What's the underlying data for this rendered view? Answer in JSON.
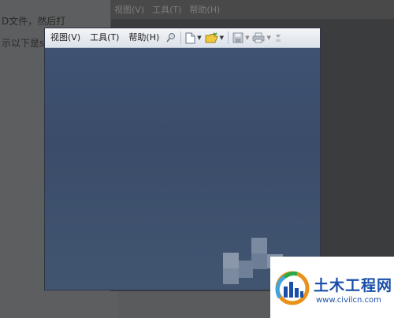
{
  "background_article": {
    "line1": "D文件，然后打",
    "line2": "示以下是s"
  },
  "background_window": {
    "menu": [
      "视图(V)",
      "工具(T)",
      "帮助(H)"
    ]
  },
  "menubar": {
    "view_label": "视图(V)",
    "tools_label": "工具(T)",
    "help_label": "帮助(H)"
  },
  "icons": {
    "help": "help-search-icon",
    "new": "new-document-icon",
    "open": "open-folder-icon",
    "save": "save-icon",
    "print": "print-icon",
    "more": "more-icon"
  },
  "colors": {
    "canvas": "#3e506b",
    "menubar": "#e6eaf0",
    "brand": "#1a4fa8"
  },
  "logo": {
    "title": "土木工程网",
    "url": "www.civilcn.com"
  }
}
